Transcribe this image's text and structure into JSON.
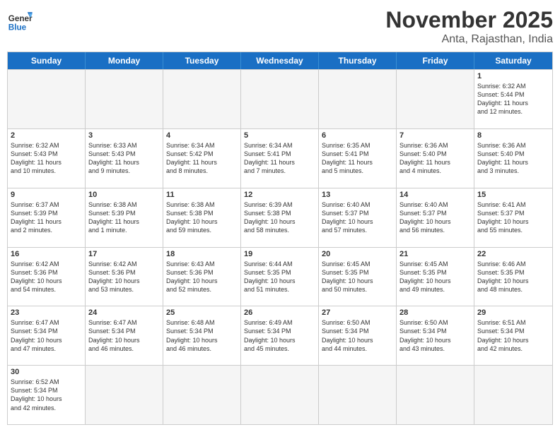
{
  "header": {
    "logo_general": "General",
    "logo_blue": "Blue",
    "month_title": "November 2025",
    "subtitle": "Anta, Rajasthan, India"
  },
  "weekdays": [
    "Sunday",
    "Monday",
    "Tuesday",
    "Wednesday",
    "Thursday",
    "Friday",
    "Saturday"
  ],
  "weeks": [
    [
      {
        "day": "",
        "info": ""
      },
      {
        "day": "",
        "info": ""
      },
      {
        "day": "",
        "info": ""
      },
      {
        "day": "",
        "info": ""
      },
      {
        "day": "",
        "info": ""
      },
      {
        "day": "",
        "info": ""
      },
      {
        "day": "1",
        "info": "Sunrise: 6:32 AM\nSunset: 5:44 PM\nDaylight: 11 hours\nand 12 minutes."
      }
    ],
    [
      {
        "day": "2",
        "info": "Sunrise: 6:32 AM\nSunset: 5:43 PM\nDaylight: 11 hours\nand 10 minutes."
      },
      {
        "day": "3",
        "info": "Sunrise: 6:33 AM\nSunset: 5:43 PM\nDaylight: 11 hours\nand 9 minutes."
      },
      {
        "day": "4",
        "info": "Sunrise: 6:34 AM\nSunset: 5:42 PM\nDaylight: 11 hours\nand 8 minutes."
      },
      {
        "day": "5",
        "info": "Sunrise: 6:34 AM\nSunset: 5:41 PM\nDaylight: 11 hours\nand 7 minutes."
      },
      {
        "day": "6",
        "info": "Sunrise: 6:35 AM\nSunset: 5:41 PM\nDaylight: 11 hours\nand 5 minutes."
      },
      {
        "day": "7",
        "info": "Sunrise: 6:36 AM\nSunset: 5:40 PM\nDaylight: 11 hours\nand 4 minutes."
      },
      {
        "day": "8",
        "info": "Sunrise: 6:36 AM\nSunset: 5:40 PM\nDaylight: 11 hours\nand 3 minutes."
      }
    ],
    [
      {
        "day": "9",
        "info": "Sunrise: 6:37 AM\nSunset: 5:39 PM\nDaylight: 11 hours\nand 2 minutes."
      },
      {
        "day": "10",
        "info": "Sunrise: 6:38 AM\nSunset: 5:39 PM\nDaylight: 11 hours\nand 1 minute."
      },
      {
        "day": "11",
        "info": "Sunrise: 6:38 AM\nSunset: 5:38 PM\nDaylight: 10 hours\nand 59 minutes."
      },
      {
        "day": "12",
        "info": "Sunrise: 6:39 AM\nSunset: 5:38 PM\nDaylight: 10 hours\nand 58 minutes."
      },
      {
        "day": "13",
        "info": "Sunrise: 6:40 AM\nSunset: 5:37 PM\nDaylight: 10 hours\nand 57 minutes."
      },
      {
        "day": "14",
        "info": "Sunrise: 6:40 AM\nSunset: 5:37 PM\nDaylight: 10 hours\nand 56 minutes."
      },
      {
        "day": "15",
        "info": "Sunrise: 6:41 AM\nSunset: 5:37 PM\nDaylight: 10 hours\nand 55 minutes."
      }
    ],
    [
      {
        "day": "16",
        "info": "Sunrise: 6:42 AM\nSunset: 5:36 PM\nDaylight: 10 hours\nand 54 minutes."
      },
      {
        "day": "17",
        "info": "Sunrise: 6:42 AM\nSunset: 5:36 PM\nDaylight: 10 hours\nand 53 minutes."
      },
      {
        "day": "18",
        "info": "Sunrise: 6:43 AM\nSunset: 5:36 PM\nDaylight: 10 hours\nand 52 minutes."
      },
      {
        "day": "19",
        "info": "Sunrise: 6:44 AM\nSunset: 5:35 PM\nDaylight: 10 hours\nand 51 minutes."
      },
      {
        "day": "20",
        "info": "Sunrise: 6:45 AM\nSunset: 5:35 PM\nDaylight: 10 hours\nand 50 minutes."
      },
      {
        "day": "21",
        "info": "Sunrise: 6:45 AM\nSunset: 5:35 PM\nDaylight: 10 hours\nand 49 minutes."
      },
      {
        "day": "22",
        "info": "Sunrise: 6:46 AM\nSunset: 5:35 PM\nDaylight: 10 hours\nand 48 minutes."
      }
    ],
    [
      {
        "day": "23",
        "info": "Sunrise: 6:47 AM\nSunset: 5:34 PM\nDaylight: 10 hours\nand 47 minutes."
      },
      {
        "day": "24",
        "info": "Sunrise: 6:47 AM\nSunset: 5:34 PM\nDaylight: 10 hours\nand 46 minutes."
      },
      {
        "day": "25",
        "info": "Sunrise: 6:48 AM\nSunset: 5:34 PM\nDaylight: 10 hours\nand 46 minutes."
      },
      {
        "day": "26",
        "info": "Sunrise: 6:49 AM\nSunset: 5:34 PM\nDaylight: 10 hours\nand 45 minutes."
      },
      {
        "day": "27",
        "info": "Sunrise: 6:50 AM\nSunset: 5:34 PM\nDaylight: 10 hours\nand 44 minutes."
      },
      {
        "day": "28",
        "info": "Sunrise: 6:50 AM\nSunset: 5:34 PM\nDaylight: 10 hours\nand 43 minutes."
      },
      {
        "day": "29",
        "info": "Sunrise: 6:51 AM\nSunset: 5:34 PM\nDaylight: 10 hours\nand 42 minutes."
      }
    ],
    [
      {
        "day": "30",
        "info": "Sunrise: 6:52 AM\nSunset: 5:34 PM\nDaylight: 10 hours\nand 42 minutes."
      },
      {
        "day": "",
        "info": ""
      },
      {
        "day": "",
        "info": ""
      },
      {
        "day": "",
        "info": ""
      },
      {
        "day": "",
        "info": ""
      },
      {
        "day": "",
        "info": ""
      },
      {
        "day": "",
        "info": ""
      }
    ]
  ]
}
